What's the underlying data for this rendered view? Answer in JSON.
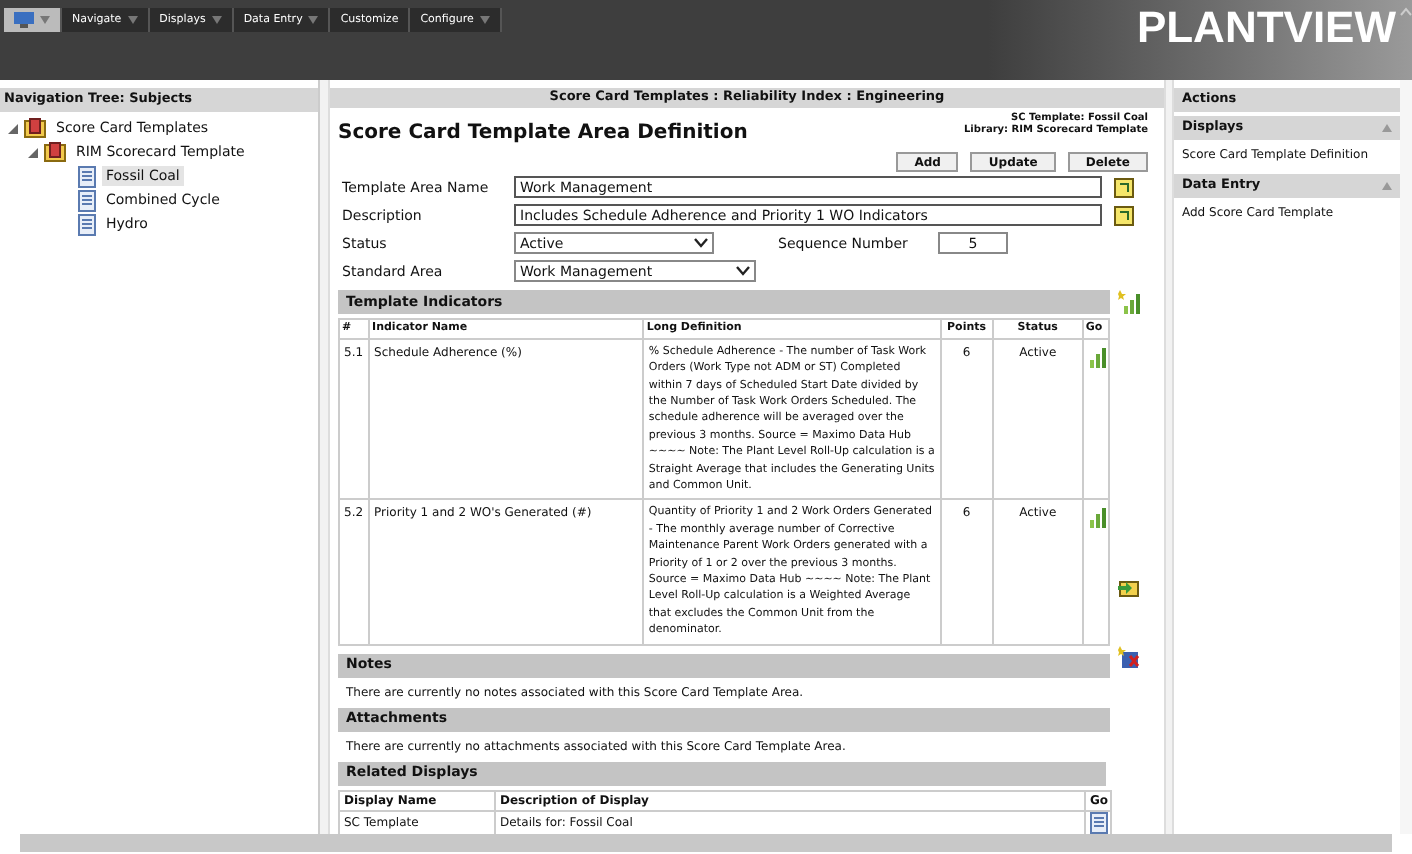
{
  "menu": [
    {
      "kind": "logo",
      "dropdown": true
    },
    {
      "label": "Navigate",
      "kind": "text",
      "dropdown": true
    },
    {
      "label": "Displays",
      "kind": "text",
      "dropdown": true
    },
    {
      "label": "Data Entry",
      "kind": "text",
      "dropdown": true
    },
    {
      "label": "Customize",
      "kind": "text",
      "dropdown": false
    },
    {
      "label": "Configure",
      "kind": "text",
      "dropdown": true
    }
  ],
  "brand": "PLANTVIEW",
  "nav_tree": {
    "title": "Navigation Tree: Subjects",
    "items": [
      {
        "label": "Score Card Templates",
        "kind": "folder",
        "expanded": true,
        "children": [
          {
            "label": "RIM Scorecard Template",
            "kind": "folder",
            "expanded": true,
            "children": [
              {
                "label": "Fossil Coal",
                "kind": "page",
                "selected": true
              },
              {
                "label": "Combined Cycle",
                "kind": "page",
                "selected": false
              },
              {
                "label": "Hydro",
                "kind": "page",
                "selected": false
              }
            ]
          }
        ]
      }
    ]
  },
  "content": {
    "breadcrumb": "Score Card Templates : Reliability Index : Engineering",
    "heading": "Score Card Template Area Definition",
    "info": [
      "SC Template: Fossil Coal",
      "Library: RIM Scorecard Template"
    ],
    "buttons": [
      "Add",
      "Update",
      "Delete"
    ],
    "fields": {
      "template_area_name": {
        "label": "Template Area Name",
        "value": "Work Management"
      },
      "description": {
        "label": "Description",
        "value": "Includes Schedule Adherence and Priority 1 WO Indicators"
      },
      "status": {
        "label": "Status",
        "value": "Active"
      },
      "sequence_number": {
        "label": "Sequence Number",
        "value": "5"
      },
      "standard_area": {
        "label": "Standard Area",
        "value": "Work Management"
      }
    },
    "indicators": {
      "title": "Template Indicators",
      "columns": [
        "#",
        "Indicator Name",
        "Long Definition",
        "Points",
        "Status",
        "Go"
      ],
      "rows": [
        {
          "number": "5.1",
          "name": "Schedule Adherence (%)",
          "definition": "% Schedule Adherence - The number of Task Work Orders (Work Type not ADM or ST) Completed within 7 days of Scheduled Start Date divided by the Number of Task Work Orders Scheduled.  The schedule adherence will be averaged over the previous 3 months. Source = Maximo Data Hub ~~~~ Note: The Plant Level Roll-Up calculation is a Straight Average that includes the Generating Units and Common Unit.",
          "points": "6",
          "status": "Active"
        },
        {
          "number": "5.2",
          "name": "Priority 1 and 2 WO's Generated (#)",
          "definition": "Quantity of Priority 1 and 2 Work Orders Generated - The monthly average number of Corrective Maintenance Parent Work Orders generated with a Priority of 1 or 2 over the previous 3 months. Source = Maximo Data Hub ~~~~ Note: The Plant Level Roll-Up calculation is a Weighted Average that excludes the Common Unit from the denominator.",
          "points": "6",
          "status": "Active"
        }
      ]
    },
    "notes": {
      "title": "Notes",
      "text": "There are currently no notes associated with this Score Card Template Area."
    },
    "attachments": {
      "title": "Attachments",
      "text": "There are currently no attachments associated with this Score Card Template Area."
    },
    "related": {
      "title": "Related Displays",
      "columns": [
        "Display Name",
        "Description of Display",
        "Go"
      ],
      "rows": [
        {
          "name": "SC Template",
          "description": "Details for: Fossil Coal"
        }
      ]
    }
  },
  "actions": {
    "title": "Actions",
    "groups": [
      {
        "title": "Displays",
        "expanded": true,
        "items": [
          "Score Card Template Definition"
        ]
      },
      {
        "title": "Data Entry",
        "expanded": true,
        "items": [
          "Add Score Card Template"
        ]
      }
    ]
  }
}
